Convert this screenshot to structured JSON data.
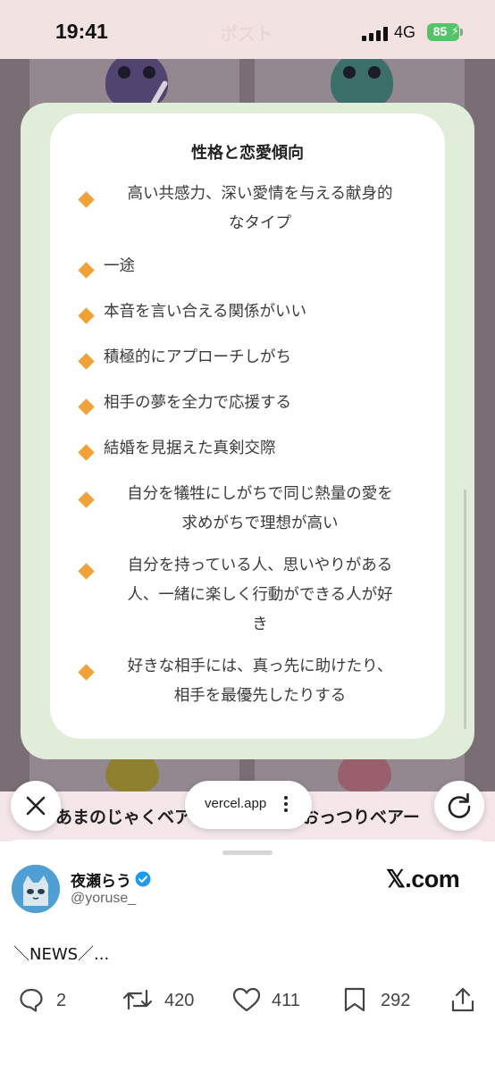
{
  "status_bar": {
    "time": "19:41",
    "network": "4G",
    "battery": "85",
    "ghost_title": "ポスト"
  },
  "background": {
    "left_name": "あまのじゃくベア",
    "right_name": "おっつりベアー"
  },
  "modal": {
    "title": "性格と恋愛傾向",
    "traits": [
      [
        "高い共感力、深い愛情を与える献身的",
        "なタイプ"
      ],
      [
        "一途"
      ],
      [
        "本音を言い合える関係がいい"
      ],
      [
        "積極的にアプローチしがち"
      ],
      [
        "相手の夢を全力で応援する"
      ],
      [
        "結婚を見据えた真剣交際"
      ],
      [
        "自分を犠牲にしがちで同じ熱量の愛を",
        "求めがちで理想が高い"
      ],
      [
        "自分を持っている人、思いやりがある",
        "人、一緒に楽しく行動ができる人が好",
        "き"
      ],
      [
        "好きな相手には、真っ先に助けたり、",
        "相手を最優先したりする"
      ]
    ]
  },
  "browser": {
    "url": "vercel.app",
    "close_icon": "close-icon",
    "reload_icon": "reload-icon"
  },
  "post": {
    "display_name": "夜瀬らう",
    "handle": "@yoruse_",
    "site": "𝕏.com",
    "text": "＼NEWS／...",
    "replies": "2",
    "reposts": "420",
    "likes": "411",
    "bookmarks": "292"
  },
  "colors": {
    "accent_diamond": "#f0a137",
    "modal_bg": "#e0eed9",
    "battery": "#57c26a",
    "verified": "#1d9bf0"
  }
}
